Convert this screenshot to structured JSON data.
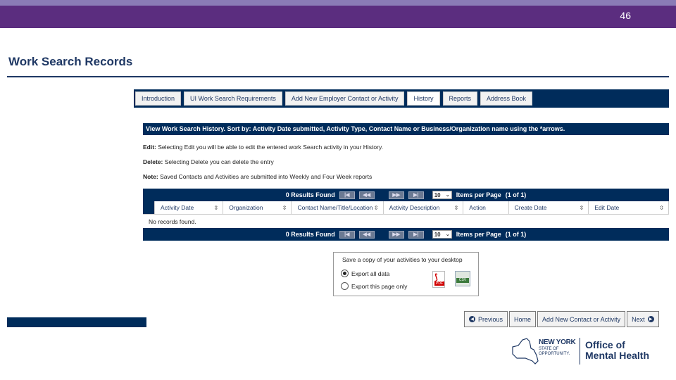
{
  "slide": {
    "number": "46",
    "title": "Work Search Records"
  },
  "tabs": [
    {
      "label": "Introduction"
    },
    {
      "label": "UI Work Search Requirements"
    },
    {
      "label": "Add New Employer Contact or Activity"
    },
    {
      "label": "History",
      "active": true
    },
    {
      "label": "Reports"
    },
    {
      "label": "Address Book"
    }
  ],
  "history": {
    "header": "View Work Search History. Sort by: Activity Date submitted, Activity Type, Contact Name or Business/Organization name using the *arrows.",
    "notes": {
      "edit_label": "Edit:",
      "edit_text": " Selecting Edit you will be able to edit the entered work Search activity in your History.",
      "delete_label": "Delete:",
      "delete_text": " Selecting Delete you can delete the entry",
      "note_label": "Note:",
      "note_text": " Saved Contacts and Activities are submitted into Weekly and Four Week reports"
    }
  },
  "grid": {
    "results_top": "0 Results Found",
    "results_bottom": "0 Results Found",
    "first_btn": "|◀",
    "prev_btn": "◀◀",
    "next_btn": "▶▶",
    "last_btn": "▶|",
    "per_page_value": "10",
    "items_per_page": "Items per Page",
    "page_info": "(1 of 1)",
    "columns": [
      "Activity Date",
      "Organization",
      "Contact Name/Title/Location",
      "Activity Description",
      "Action",
      "Create Date",
      "Edit Date"
    ],
    "no_records": "No records found."
  },
  "export": {
    "title": "Save a copy of your activities to your desktop",
    "option_all": "Export all data",
    "option_page": "Export this page only",
    "selected": "all",
    "pdf_tag": "PDF",
    "csv_tag": "CSV"
  },
  "nav_buttons": {
    "previous": "Previous",
    "home": "Home",
    "add_contact": "Add New Contact or Activity",
    "next": "Next"
  },
  "logo": {
    "state_line1": "NEW YORK",
    "state_line2": "STATE OF OPPORTUNITY.",
    "office_line1": "Office of",
    "office_line2": "Mental Health"
  },
  "colors": {
    "navy": "#002c5b",
    "purple": "#5b2d7f",
    "title": "#1f3864"
  }
}
